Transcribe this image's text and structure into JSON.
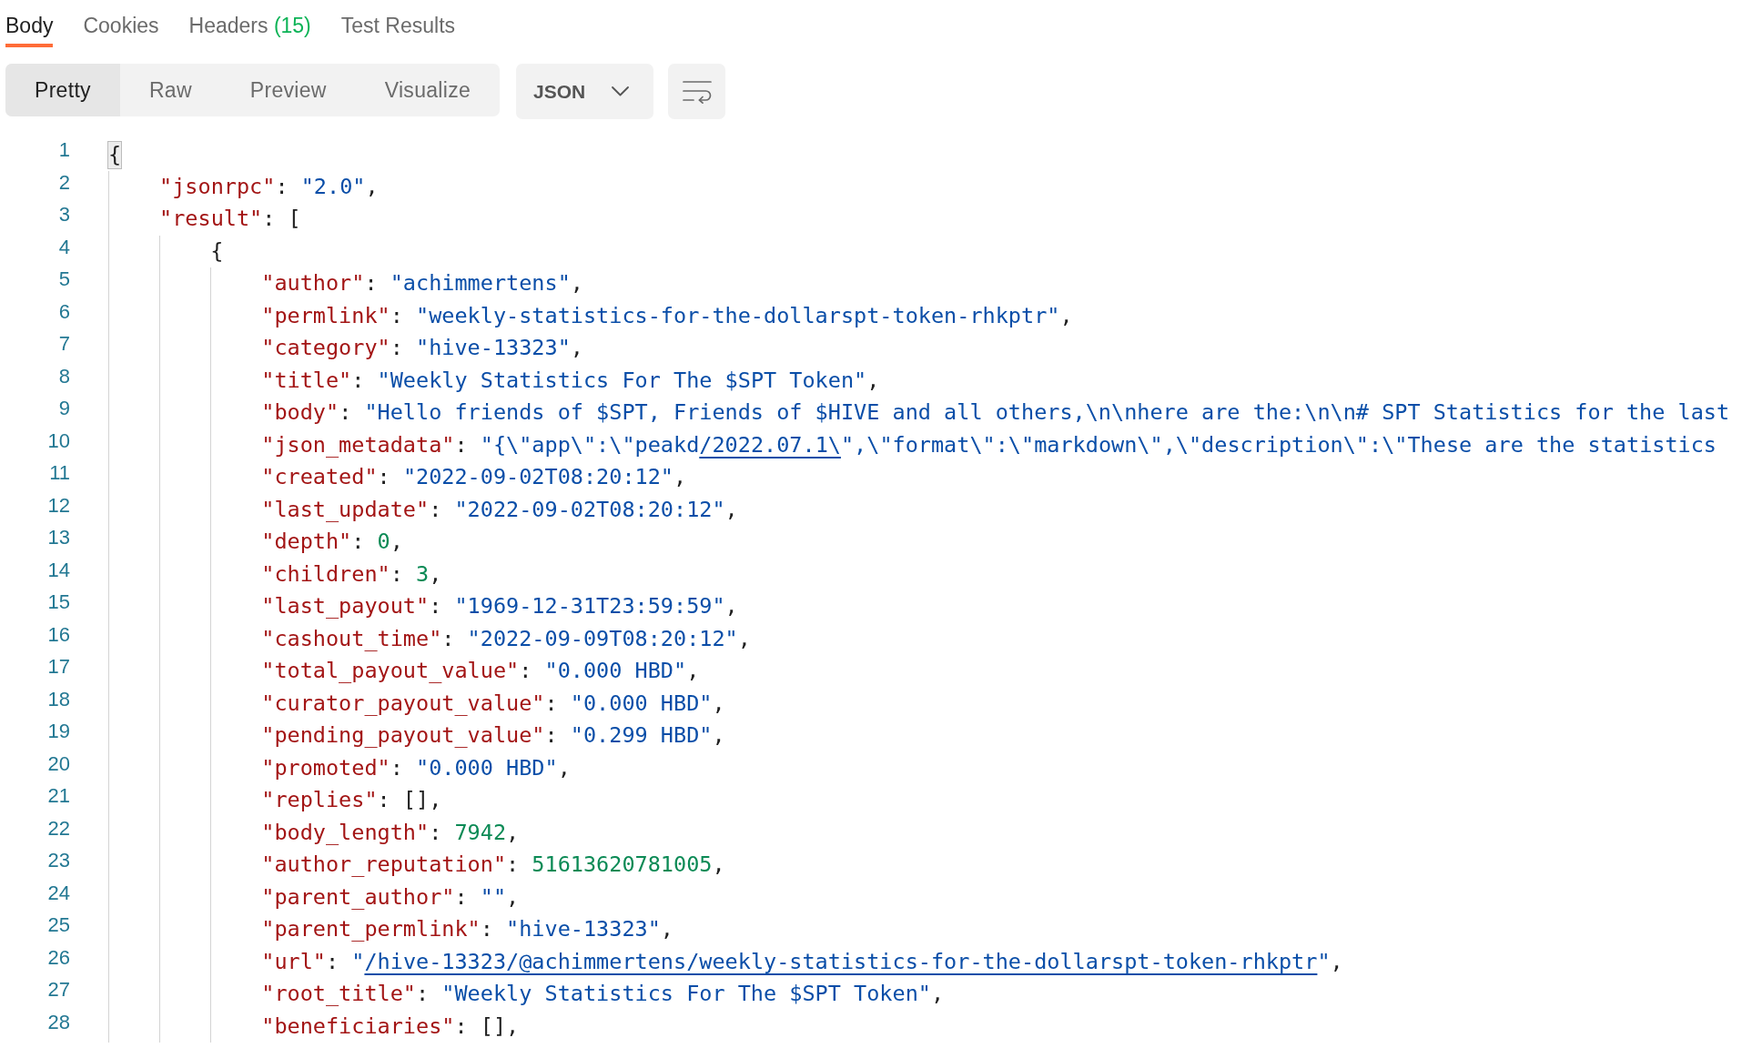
{
  "tabs": [
    {
      "label": "Body",
      "selected": true
    },
    {
      "label": "Cookies",
      "selected": false
    },
    {
      "label": "Headers",
      "count": "(15)",
      "selected": false
    },
    {
      "label": "Test Results",
      "selected": false
    }
  ],
  "view_modes": [
    {
      "label": "Pretty",
      "selected": true
    },
    {
      "label": "Raw",
      "selected": false
    },
    {
      "label": "Preview",
      "selected": false
    },
    {
      "label": "Visualize",
      "selected": false
    }
  ],
  "format_select": {
    "value": "JSON"
  },
  "editor": {
    "lines": [
      {
        "number": "1",
        "tokens": [
          {
            "kind": "bracket_match",
            "text": "{"
          }
        ],
        "children": [
          {
            "number": "2",
            "tokens": [
              {
                "kind": "key",
                "text": "\"jsonrpc\""
              },
              {
                "kind": "punct",
                "text": ": "
              },
              {
                "kind": "string",
                "text": "\"2.0\""
              },
              {
                "kind": "punct",
                "text": ","
              }
            ]
          },
          {
            "number": "3",
            "tokens": [
              {
                "kind": "key",
                "text": "\"result\""
              },
              {
                "kind": "punct",
                "text": ": ["
              }
            ],
            "children": [
              {
                "number": "4",
                "tokens": [
                  {
                    "kind": "punct",
                    "text": "{"
                  }
                ],
                "children": [
                  {
                    "number": "5",
                    "tokens": [
                      {
                        "kind": "key",
                        "text": "\"author\""
                      },
                      {
                        "kind": "punct",
                        "text": ": "
                      },
                      {
                        "kind": "string",
                        "text": "\"achimmertens\""
                      },
                      {
                        "kind": "punct",
                        "text": ","
                      }
                    ]
                  },
                  {
                    "number": "6",
                    "tokens": [
                      {
                        "kind": "key",
                        "text": "\"permlink\""
                      },
                      {
                        "kind": "punct",
                        "text": ": "
                      },
                      {
                        "kind": "string",
                        "text": "\"weekly-statistics-for-the-dollarspt-token-rhkptr\""
                      },
                      {
                        "kind": "punct",
                        "text": ","
                      }
                    ]
                  },
                  {
                    "number": "7",
                    "tokens": [
                      {
                        "kind": "key",
                        "text": "\"category\""
                      },
                      {
                        "kind": "punct",
                        "text": ": "
                      },
                      {
                        "kind": "string",
                        "text": "\"hive-13323\""
                      },
                      {
                        "kind": "punct",
                        "text": ","
                      }
                    ]
                  },
                  {
                    "number": "8",
                    "tokens": [
                      {
                        "kind": "key",
                        "text": "\"title\""
                      },
                      {
                        "kind": "punct",
                        "text": ": "
                      },
                      {
                        "kind": "string",
                        "text": "\"Weekly Statistics For The $SPT Token\""
                      },
                      {
                        "kind": "punct",
                        "text": ","
                      }
                    ]
                  },
                  {
                    "number": "9",
                    "tokens": [
                      {
                        "kind": "key",
                        "text": "\"body\""
                      },
                      {
                        "kind": "punct",
                        "text": ": "
                      },
                      {
                        "kind": "string",
                        "text": "\"Hello friends of $SPT, Friends of $HIVE and all others,\\n\\nhere are the:\\n\\n# SPT Statistics for the last"
                      }
                    ]
                  },
                  {
                    "number": "10",
                    "tokens": [
                      {
                        "kind": "key",
                        "text": "\"json_metadata\""
                      },
                      {
                        "kind": "punct",
                        "text": ": "
                      },
                      {
                        "kind": "string",
                        "text": "\"{\\\"app\\\":\\\"peakd"
                      },
                      {
                        "kind": "link",
                        "text": "/2022.07.1\\"
                      },
                      {
                        "kind": "string",
                        "text": "\",\\\"format\\\":\\\"markdown\\\",\\\"description\\\":\\\"These are the statistics"
                      }
                    ]
                  },
                  {
                    "number": "11",
                    "tokens": [
                      {
                        "kind": "key",
                        "text": "\"created\""
                      },
                      {
                        "kind": "punct",
                        "text": ": "
                      },
                      {
                        "kind": "string",
                        "text": "\"2022-09-02T08:20:12\""
                      },
                      {
                        "kind": "punct",
                        "text": ","
                      }
                    ]
                  },
                  {
                    "number": "12",
                    "tokens": [
                      {
                        "kind": "key",
                        "text": "\"last_update\""
                      },
                      {
                        "kind": "punct",
                        "text": ": "
                      },
                      {
                        "kind": "string",
                        "text": "\"2022-09-02T08:20:12\""
                      },
                      {
                        "kind": "punct",
                        "text": ","
                      }
                    ]
                  },
                  {
                    "number": "13",
                    "tokens": [
                      {
                        "kind": "key",
                        "text": "\"depth\""
                      },
                      {
                        "kind": "punct",
                        "text": ": "
                      },
                      {
                        "kind": "number",
                        "text": "0"
                      },
                      {
                        "kind": "punct",
                        "text": ","
                      }
                    ]
                  },
                  {
                    "number": "14",
                    "tokens": [
                      {
                        "kind": "key",
                        "text": "\"children\""
                      },
                      {
                        "kind": "punct",
                        "text": ": "
                      },
                      {
                        "kind": "number",
                        "text": "3"
                      },
                      {
                        "kind": "punct",
                        "text": ","
                      }
                    ]
                  },
                  {
                    "number": "15",
                    "tokens": [
                      {
                        "kind": "key",
                        "text": "\"last_payout\""
                      },
                      {
                        "kind": "punct",
                        "text": ": "
                      },
                      {
                        "kind": "string",
                        "text": "\"1969-12-31T23:59:59\""
                      },
                      {
                        "kind": "punct",
                        "text": ","
                      }
                    ]
                  },
                  {
                    "number": "16",
                    "tokens": [
                      {
                        "kind": "key",
                        "text": "\"cashout_time\""
                      },
                      {
                        "kind": "punct",
                        "text": ": "
                      },
                      {
                        "kind": "string",
                        "text": "\"2022-09-09T08:20:12\""
                      },
                      {
                        "kind": "punct",
                        "text": ","
                      }
                    ]
                  },
                  {
                    "number": "17",
                    "tokens": [
                      {
                        "kind": "key",
                        "text": "\"total_payout_value\""
                      },
                      {
                        "kind": "punct",
                        "text": ": "
                      },
                      {
                        "kind": "string",
                        "text": "\"0.000 HBD\""
                      },
                      {
                        "kind": "punct",
                        "text": ","
                      }
                    ]
                  },
                  {
                    "number": "18",
                    "tokens": [
                      {
                        "kind": "key",
                        "text": "\"curator_payout_value\""
                      },
                      {
                        "kind": "punct",
                        "text": ": "
                      },
                      {
                        "kind": "string",
                        "text": "\"0.000 HBD\""
                      },
                      {
                        "kind": "punct",
                        "text": ","
                      }
                    ]
                  },
                  {
                    "number": "19",
                    "tokens": [
                      {
                        "kind": "key",
                        "text": "\"pending_payout_value\""
                      },
                      {
                        "kind": "punct",
                        "text": ": "
                      },
                      {
                        "kind": "string",
                        "text": "\"0.299 HBD\""
                      },
                      {
                        "kind": "punct",
                        "text": ","
                      }
                    ]
                  },
                  {
                    "number": "20",
                    "tokens": [
                      {
                        "kind": "key",
                        "text": "\"promoted\""
                      },
                      {
                        "kind": "punct",
                        "text": ": "
                      },
                      {
                        "kind": "string",
                        "text": "\"0.000 HBD\""
                      },
                      {
                        "kind": "punct",
                        "text": ","
                      }
                    ]
                  },
                  {
                    "number": "21",
                    "tokens": [
                      {
                        "kind": "key",
                        "text": "\"replies\""
                      },
                      {
                        "kind": "punct",
                        "text": ": [],"
                      }
                    ]
                  },
                  {
                    "number": "22",
                    "tokens": [
                      {
                        "kind": "key",
                        "text": "\"body_length\""
                      },
                      {
                        "kind": "punct",
                        "text": ": "
                      },
                      {
                        "kind": "number",
                        "text": "7942"
                      },
                      {
                        "kind": "punct",
                        "text": ","
                      }
                    ]
                  },
                  {
                    "number": "23",
                    "tokens": [
                      {
                        "kind": "key",
                        "text": "\"author_reputation\""
                      },
                      {
                        "kind": "punct",
                        "text": ": "
                      },
                      {
                        "kind": "number",
                        "text": "51613620781005"
                      },
                      {
                        "kind": "punct",
                        "text": ","
                      }
                    ]
                  },
                  {
                    "number": "24",
                    "tokens": [
                      {
                        "kind": "key",
                        "text": "\"parent_author\""
                      },
                      {
                        "kind": "punct",
                        "text": ": "
                      },
                      {
                        "kind": "string",
                        "text": "\"\""
                      },
                      {
                        "kind": "punct",
                        "text": ","
                      }
                    ]
                  },
                  {
                    "number": "25",
                    "tokens": [
                      {
                        "kind": "key",
                        "text": "\"parent_permlink\""
                      },
                      {
                        "kind": "punct",
                        "text": ": "
                      },
                      {
                        "kind": "string",
                        "text": "\"hive-13323\""
                      },
                      {
                        "kind": "punct",
                        "text": ","
                      }
                    ]
                  },
                  {
                    "number": "26",
                    "tokens": [
                      {
                        "kind": "key",
                        "text": "\"url\""
                      },
                      {
                        "kind": "punct",
                        "text": ": "
                      },
                      {
                        "kind": "string",
                        "text": "\""
                      },
                      {
                        "kind": "link",
                        "text": "/hive-13323/@achimmertens/weekly-statistics-for-the-dollarspt-token-rhkptr"
                      },
                      {
                        "kind": "string",
                        "text": "\""
                      },
                      {
                        "kind": "punct",
                        "text": ","
                      }
                    ]
                  },
                  {
                    "number": "27",
                    "tokens": [
                      {
                        "kind": "key",
                        "text": "\"root_title\""
                      },
                      {
                        "kind": "punct",
                        "text": ": "
                      },
                      {
                        "kind": "string",
                        "text": "\"Weekly Statistics For The $SPT Token\""
                      },
                      {
                        "kind": "punct",
                        "text": ","
                      }
                    ]
                  },
                  {
                    "number": "28",
                    "tokens": [
                      {
                        "kind": "key",
                        "text": "\"beneficiaries\""
                      },
                      {
                        "kind": "punct",
                        "text": ": [],"
                      }
                    ]
                  }
                ]
              }
            ]
          }
        ]
      }
    ]
  }
}
